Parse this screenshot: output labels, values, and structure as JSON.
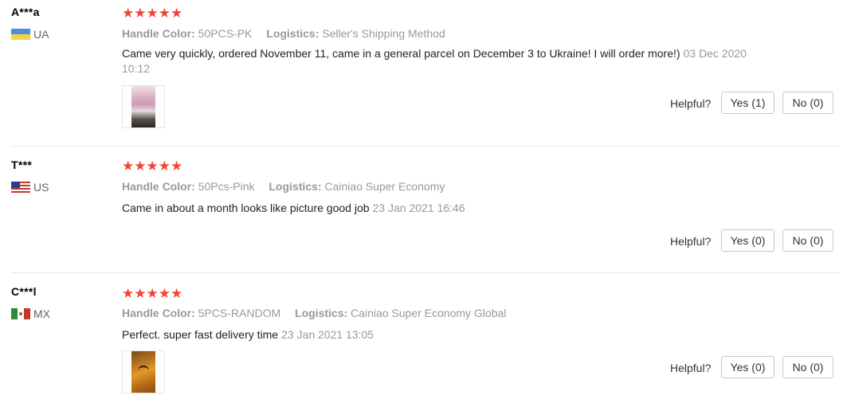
{
  "colors": {
    "star": "#f44336",
    "flag_ua_top": "#4a90d9",
    "flag_ua_bottom": "#f7d046",
    "flag_us_canton": "#2c3e8f",
    "flag_mx_green": "#2e8b3d",
    "flag_mx_red": "#c0392b"
  },
  "helpful_label": "Helpful?",
  "reviews": [
    {
      "user": "A***a",
      "country": "UA",
      "flag_icon": "ukraine-flag-icon",
      "rating": 5,
      "stars": "★★★★★",
      "handle_color_label": "Handle Color:",
      "handle_color_value": "50PCS-PK",
      "logistics_label": "Logistics:",
      "logistics_value": "Seller's Shipping Method",
      "comment": "Came very quickly, ordered November 11, came in a general parcel on December 3 to Ukraine! I will order more!)",
      "date": "03 Dec 2020 10:12",
      "has_photo": true,
      "photo_icon": "review-photo-thumbnail",
      "yes_label": "Yes (1)",
      "no_label": "No (0)"
    },
    {
      "user": "T***",
      "country": "US",
      "flag_icon": "usa-flag-icon",
      "rating": 5,
      "stars": "★★★★★",
      "handle_color_label": "Handle Color:",
      "handle_color_value": "50Pcs-Pink",
      "logistics_label": "Logistics:",
      "logistics_value": "Cainiao Super Economy",
      "comment": "Came in about a month looks like picture good job",
      "date": "23 Jan 2021 16:46",
      "has_photo": false,
      "yes_label": "Yes (0)",
      "no_label": "No (0)"
    },
    {
      "user": "C***l",
      "country": "MX",
      "flag_icon": "mexico-flag-icon",
      "rating": 5,
      "stars": "★★★★★",
      "handle_color_label": "Handle Color:",
      "handle_color_value": "5PCS-RANDOM",
      "logistics_label": "Logistics:",
      "logistics_value": "Cainiao Super Economy Global",
      "comment": "Perfect. super fast delivery time",
      "date": "23 Jan 2021 13:05",
      "has_photo": true,
      "photo_icon": "review-photo-thumbnail",
      "yes_label": "Yes (0)",
      "no_label": "No (0)"
    }
  ]
}
